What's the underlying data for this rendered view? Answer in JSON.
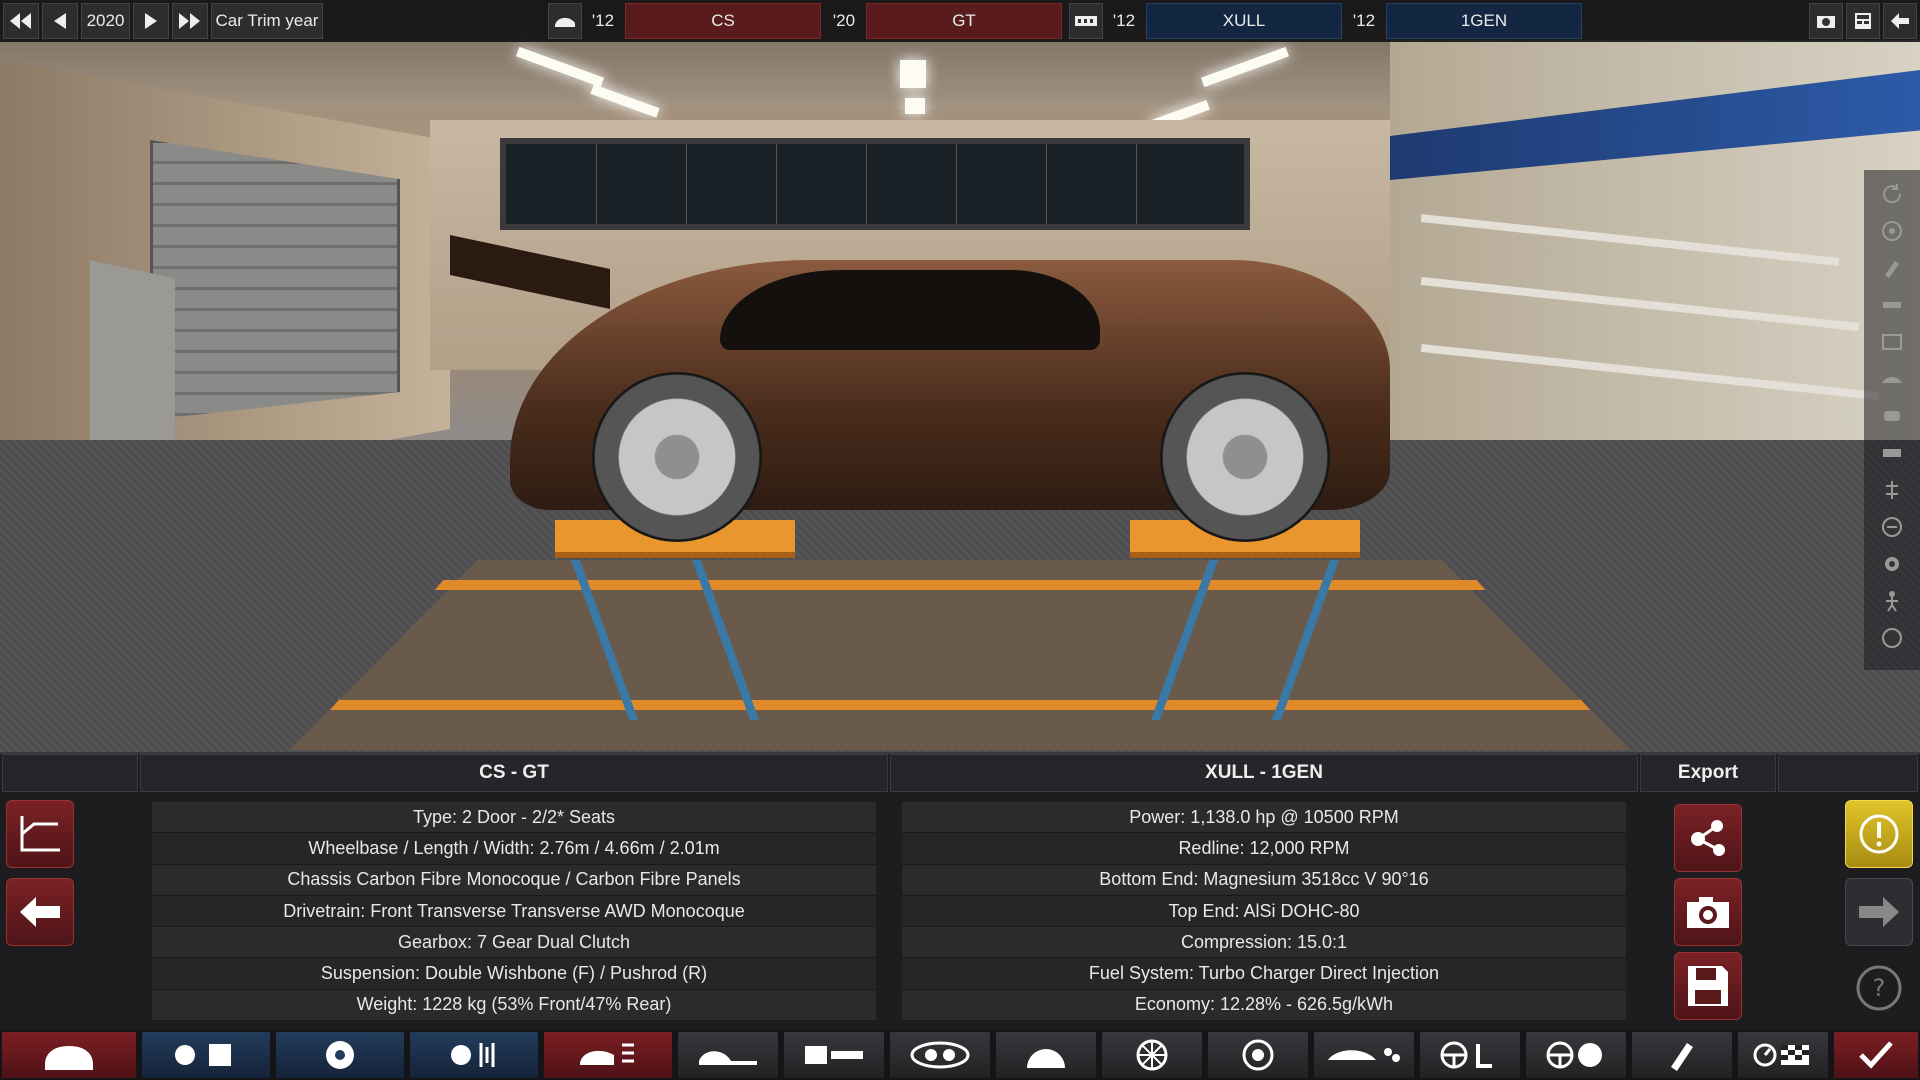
{
  "topbar": {
    "year_value": "2020",
    "year_label": "Car Trim year",
    "model_year": "'12",
    "model_name": "CS",
    "trim_year": "'20",
    "trim_name": "GT",
    "engine_year": "'12",
    "engine_name": "XULL",
    "variant_year": "'12",
    "variant_name": "1GEN",
    "icons": [
      "rewind-icon",
      "step-back-icon",
      "play-icon",
      "fast-forward-icon",
      "car-icon",
      "engine-icon",
      "camera-icon",
      "calculator-icon",
      "back-icon"
    ]
  },
  "car_panel": {
    "title": "CS - GT",
    "rows": [
      "Type: 2 Door - 2/2* Seats",
      "Wheelbase / Length / Width: 2.76m / 4.66m / 2.01m",
      "Chassis Carbon Fibre Monocoque / Carbon Fibre Panels",
      "Drivetrain: Front Transverse Transverse AWD Monocoque",
      "Gearbox: 7 Gear Dual Clutch",
      "Suspension: Double Wishbone (F) / Pushrod (R)",
      "Weight: 1228 kg (53% Front/47% Rear)"
    ]
  },
  "engine_panel": {
    "title": "XULL - 1GEN",
    "rows": [
      "Power: 1,138.0 hp @ 10500 RPM",
      "Redline:  12,000 RPM",
      "Bottom End: Magnesium 3518cc V 90°16",
      "Top End: AlSi DOHC-80",
      "Compression: 15.0:1",
      "Fuel System: Turbo Charger Direct Injection",
      "Economy: 12.28% - 626.5g/kWh"
    ]
  },
  "export": {
    "title": "Export",
    "buttons": [
      "share-icon",
      "camera-icon",
      "save-icon"
    ]
  },
  "left_buttons": [
    "chart-icon",
    "back-arrow-icon"
  ],
  "right_buttons": [
    "warning-icon",
    "forward-arrow-icon",
    "help-icon"
  ],
  "toolbar": {
    "items": [
      "car-model-icon",
      "engine-files-icon",
      "engine-design-icon",
      "engine-tune-icon",
      "car-body-icon",
      "chassis-icon",
      "suspension-icon",
      "drivetrain-icon",
      "brakes-icon",
      "wheels-icon",
      "tyres-icon",
      "aero-icon",
      "interior-icon",
      "steering-icon",
      "paint-icon",
      "test-track-icon",
      "finish-check-icon"
    ]
  },
  "colors": {
    "accent_red": "#7c1f24",
    "accent_blue": "#233c5c",
    "accent_yellow": "#e1c42a"
  }
}
